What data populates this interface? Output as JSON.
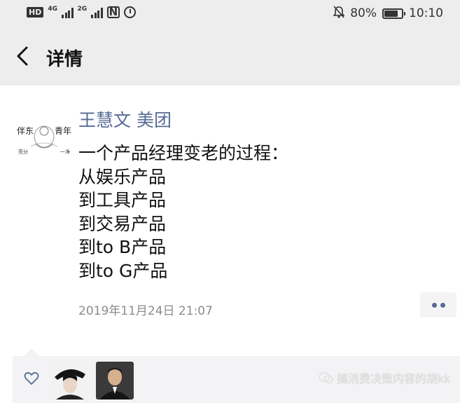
{
  "status_bar": {
    "hd_label": "HD",
    "net1": "4G",
    "net2": "2G",
    "nfc": "N",
    "battery_percent": "80%",
    "battery_level": 0.8,
    "time": "10:10"
  },
  "nav": {
    "title": "详情",
    "back_icon": "chevron-left-icon"
  },
  "post": {
    "author": "王慧文 美团",
    "lines": [
      "一个产品经理变老的过程：",
      "从娱乐产品",
      "到工具产品",
      "到交易产品",
      "到to B产品",
      "到to G产品"
    ],
    "timestamp": "2019年11月24日 21:07"
  },
  "likes": {
    "icon": "heart-icon"
  },
  "watermark": {
    "text": "搞消费决策内容的胡kk"
  },
  "colors": {
    "link": "#576b95",
    "background": "#ededed",
    "card": "#ffffff",
    "likes_panel": "#f3f3f5"
  }
}
